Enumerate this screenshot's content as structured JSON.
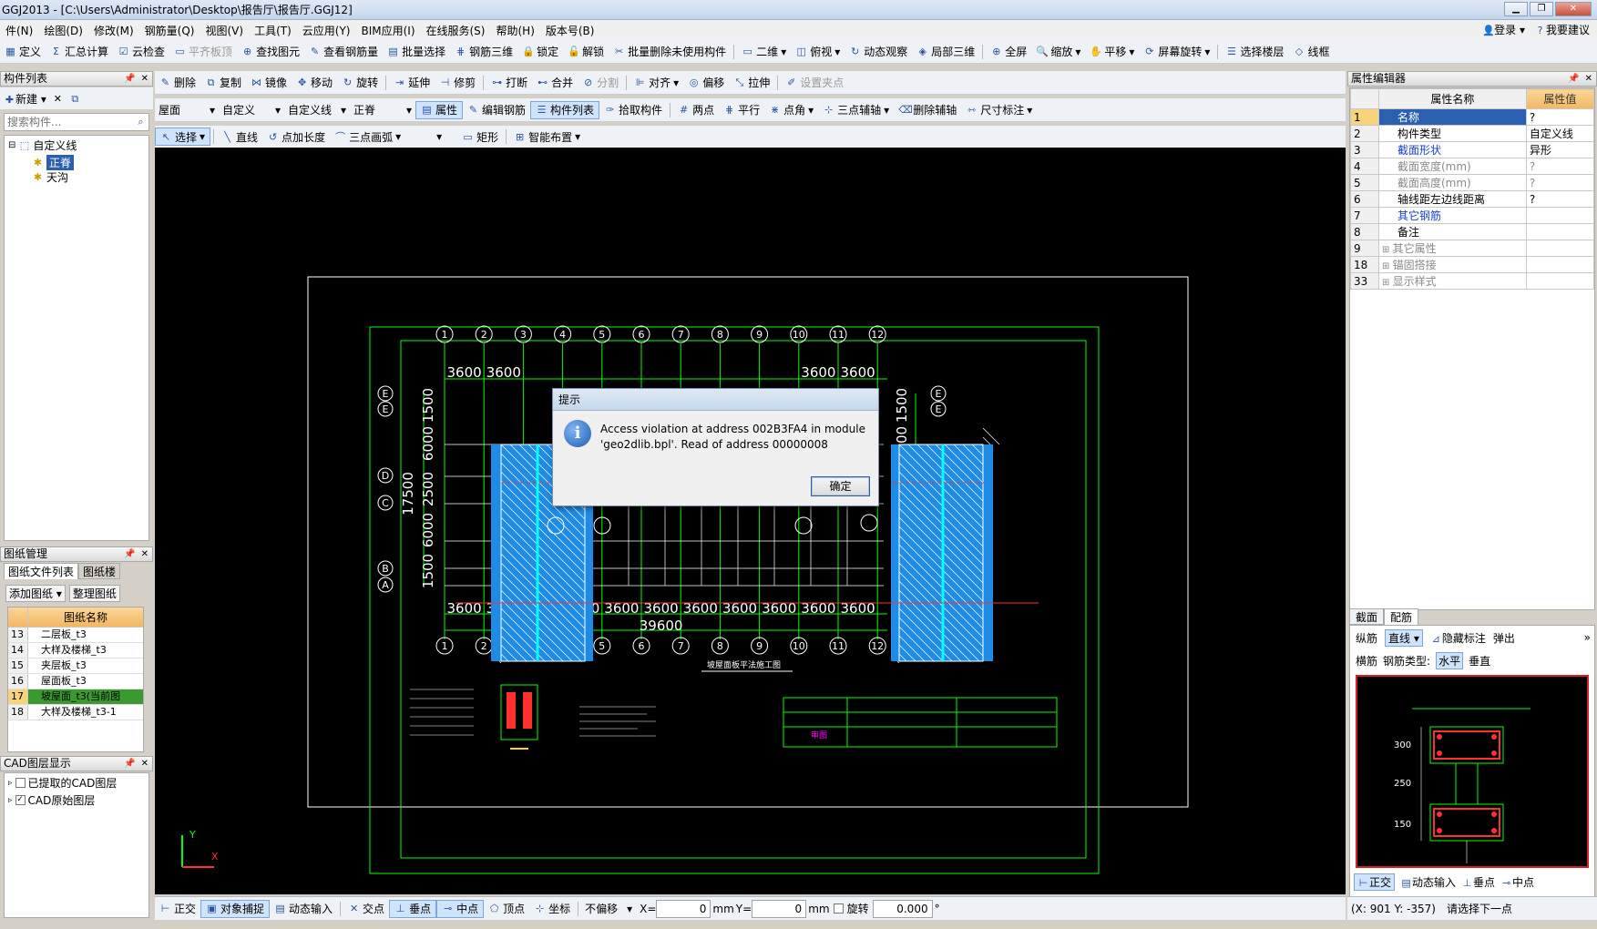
{
  "window": {
    "title": "GGJ2013 - [C:\\Users\\Administrator\\Desktop\\报告厅\\报告厅.GGJ12]"
  },
  "menu": [
    "件(N)",
    "绘图(D)",
    "修改(M)",
    "钢筋量(Q)",
    "视图(V)",
    "工具(T)",
    "云应用(Y)",
    "BIM应用(I)",
    "在线服务(S)",
    "帮助(H)",
    "版本号(B)"
  ],
  "menu_right": {
    "login": "登录",
    "suggest": "我要建议"
  },
  "toolbar1": [
    "定义",
    "汇总计算",
    "云检查",
    "平齐板顶",
    "查找图元",
    "查看钢筋量",
    "批量选择",
    "钢筋三维",
    "锁定",
    "解锁",
    "批量删除未使用构件",
    "二维",
    "俯视",
    "动态观察",
    "局部三维",
    "全屏",
    "缩放",
    "平移",
    "屏幕旋转",
    "选择楼层",
    "线框"
  ],
  "toolbar2": [
    "删除",
    "复制",
    "镜像",
    "移动",
    "旋转",
    "延伸",
    "修剪",
    "打断",
    "合并",
    "分割",
    "对齐",
    "偏移",
    "拉伸",
    "设置夹点"
  ],
  "toolbar3": {
    "floor": "屋面",
    "def1": "自定义",
    "def2": "自定义线",
    "item": "正脊",
    "buttons": [
      "属性",
      "编辑钢筋",
      "构件列表",
      "拾取构件",
      "两点",
      "平行",
      "点角",
      "三点辅轴",
      "删除辅轴",
      "尺寸标注"
    ]
  },
  "toolbar4": [
    "选择",
    "直线",
    "点加长度",
    "三点画弧",
    "矩形",
    "智能布置"
  ],
  "component_panel": {
    "title": "构件列表",
    "new_btn": "新建",
    "search_placeholder": "搜索构件...",
    "tree": {
      "root": "自定义线",
      "children": [
        "正脊",
        "天沟"
      ],
      "selected": "正脊"
    }
  },
  "drawing_panel": {
    "title": "图纸管理",
    "tabs": [
      "图纸文件列表",
      "图纸楼"
    ],
    "buttons": [
      "添加图纸",
      "整理图纸"
    ],
    "col_header": "图纸名称",
    "rows": [
      {
        "n": "13",
        "name": "二层板_t3"
      },
      {
        "n": "14",
        "name": "大样及楼梯_t3"
      },
      {
        "n": "15",
        "name": "夹层板_t3"
      },
      {
        "n": "16",
        "name": "屋面板_t3"
      },
      {
        "n": "17",
        "name": "坡屋面_t3(当前图"
      },
      {
        "n": "18",
        "name": "大样及楼梯_t3-1"
      }
    ],
    "current": "17"
  },
  "cad_panel": {
    "title": "CAD图层显示",
    "layers": [
      "已提取的CAD图层",
      "CAD原始图层"
    ]
  },
  "prop_panel": {
    "title": "属性编辑器",
    "headers": [
      "属性名称",
      "属性值"
    ],
    "rows": [
      {
        "n": "1",
        "name": "名称",
        "value": "?",
        "blue": true,
        "sel": true
      },
      {
        "n": "2",
        "name": "构件类型",
        "value": "自定义线"
      },
      {
        "n": "3",
        "name": "截面形状",
        "value": "异形",
        "blue": true
      },
      {
        "n": "4",
        "name": "截面宽度(mm)",
        "value": "?",
        "gray": true
      },
      {
        "n": "5",
        "name": "截面高度(mm)",
        "value": "?",
        "gray": true
      },
      {
        "n": "6",
        "name": "轴线距左边线距离",
        "value": "?"
      },
      {
        "n": "7",
        "name": "其它钢筋",
        "value": "",
        "blue": true
      },
      {
        "n": "8",
        "name": "备注",
        "value": ""
      },
      {
        "n": "9",
        "name": "其它属性",
        "value": "",
        "exp": true
      },
      {
        "n": "18",
        "name": "锚固搭接",
        "value": "",
        "exp": true
      },
      {
        "n": "33",
        "name": "显示样式",
        "value": "",
        "exp": true
      }
    ]
  },
  "section_panel": {
    "tabs": [
      "截面",
      "配筋"
    ],
    "row1": [
      "纵筋",
      "直线",
      "隐藏标注",
      "弹出"
    ],
    "row2": {
      "label": "横筋",
      "type_label": "钢筋类型:",
      "h": "水平",
      "v": "垂直"
    },
    "bottom": [
      "正交",
      "动态输入",
      "垂点",
      "中点"
    ],
    "dims": [
      "300",
      "250",
      "150"
    ]
  },
  "dialog": {
    "title": "提示",
    "message1": "Access violation at address 002B3FA4 in module",
    "message2": "'geo2dlib.bpl'. Read of address 00000008",
    "ok": "确定"
  },
  "cad": {
    "axes_numbers": [
      "1",
      "2",
      "3",
      "4",
      "5",
      "6",
      "7",
      "8",
      "9",
      "10",
      "11",
      "12"
    ],
    "dims_top": [
      "3600",
      "3600",
      "3600",
      "3600"
    ],
    "dims_bottom": [
      "3600",
      "3600",
      "3600",
      "3600",
      "3600",
      "3600",
      "3600",
      "3600",
      "3600",
      "3600",
      "3600"
    ],
    "total_width": "39600",
    "row_labels_left": [
      "E",
      "E",
      "D",
      "C",
      "B",
      "A"
    ],
    "vdims": [
      "1500",
      "6000",
      "2500",
      "6000",
      "1500"
    ],
    "total_height": "17500",
    "plan_title": "坡屋面板平法施工图",
    "tb_stamp": "审图"
  },
  "statusbar": {
    "buttons": [
      "正交",
      "对象捕捉",
      "动态输入",
      "交点",
      "垂点",
      "中点",
      "顶点",
      "坐标"
    ],
    "offset": "不偏移",
    "x_label": "X=",
    "x": "0",
    "y_label": "Y=",
    "y": "0",
    "unit": "mm",
    "rotate": "旋转",
    "rotate_val": "0.000",
    "deg": "°",
    "coords": "(X: 901 Y: -357)",
    "hint": "请选择下一点"
  },
  "colors": {
    "accent": "#cfe3fb",
    "cad_green": "#00ff00",
    "selected_row": "#3b9a2f"
  }
}
